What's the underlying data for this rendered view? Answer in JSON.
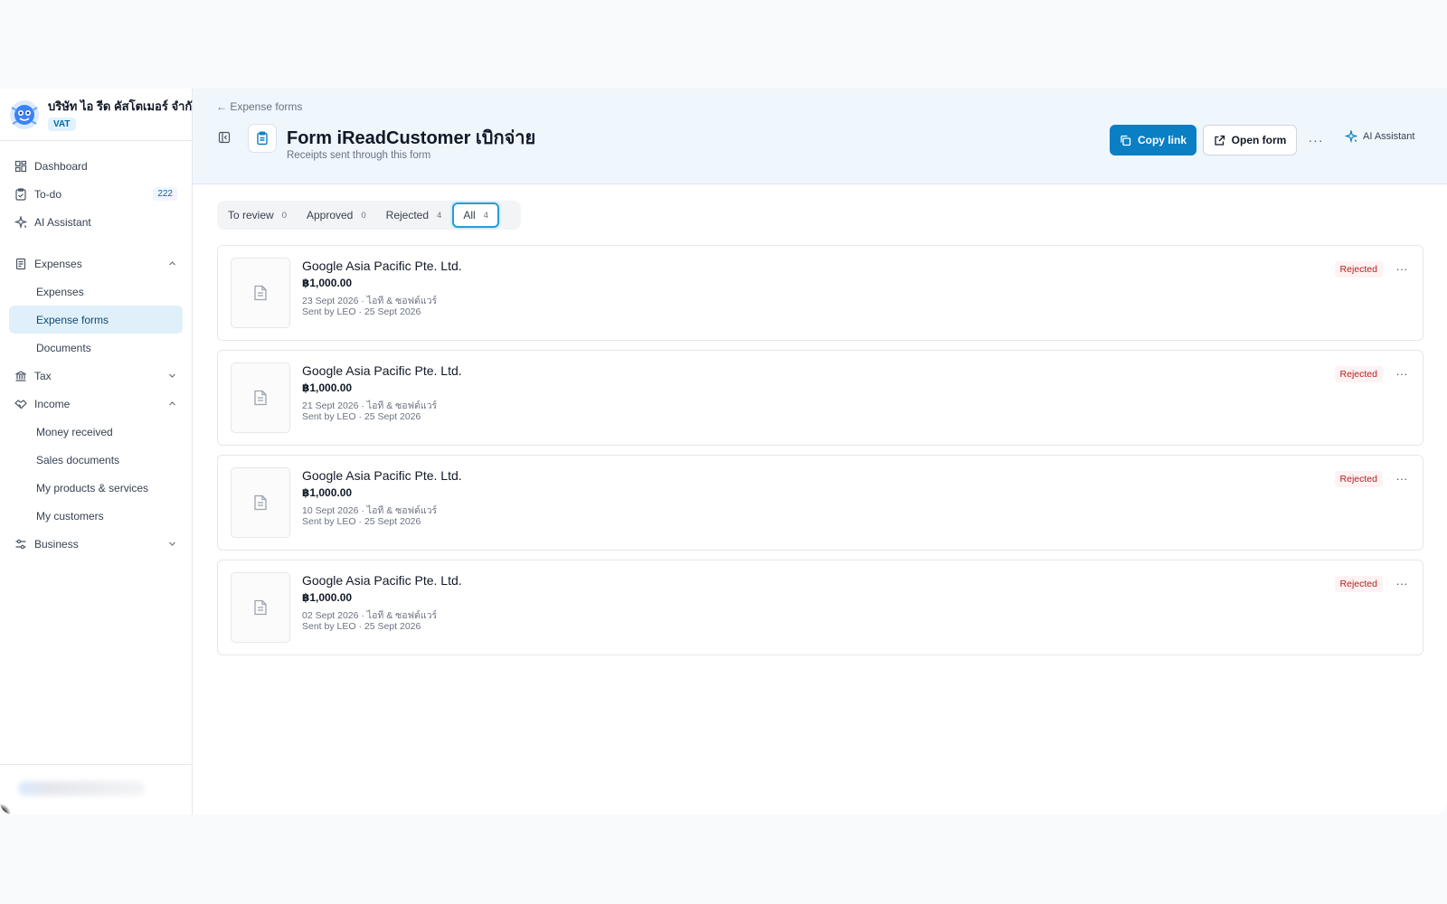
{
  "org": {
    "name": "บริษัท ไอ รีด คัสโตเมอร์ จำกัด",
    "badge": "VAT"
  },
  "sidebar": {
    "items": [
      {
        "label": "Dashboard",
        "icon": "dashboard-icon"
      },
      {
        "label": "To-do",
        "icon": "clipboard-check-icon",
        "count": "222"
      },
      {
        "label": "AI Assistant",
        "icon": "sparkle-icon"
      },
      {
        "label": "Expenses",
        "icon": "receipt-icon",
        "expanded": true
      },
      {
        "label": "Expenses"
      },
      {
        "label": "Expense forms",
        "active": true
      },
      {
        "label": "Documents"
      },
      {
        "label": "Tax",
        "icon": "bank-icon",
        "expanded": false
      },
      {
        "label": "Income",
        "icon": "handshake-icon",
        "expanded": true
      },
      {
        "label": "Money received"
      },
      {
        "label": "Sales documents"
      },
      {
        "label": "My products & services"
      },
      {
        "label": "My customers"
      },
      {
        "label": "Business",
        "icon": "sliders-icon",
        "expanded": false
      }
    ]
  },
  "header": {
    "back_label": "← Expense forms",
    "title": "Form iReadCustomer เบิกจ่าย",
    "subtitle": "Receipts sent through this form",
    "copy_link": "Copy link",
    "open_form": "Open form",
    "more": "···",
    "ai_assistant": "AI Assistant"
  },
  "tabs": [
    {
      "label": "To review",
      "count": "0"
    },
    {
      "label": "Approved",
      "count": "0"
    },
    {
      "label": "Rejected",
      "count": "4"
    },
    {
      "label": "All",
      "count": "4",
      "active": true
    }
  ],
  "receipts": [
    {
      "vendor": "Google Asia Pacific Pte. Ltd.",
      "amount": "฿1,000.00",
      "meta": "23 Sept 2026 · ไอที & ซอฟต์แวร์",
      "sent": "Sent by LEO · 25 Sept 2026",
      "status": "Rejected"
    },
    {
      "vendor": "Google Asia Pacific Pte. Ltd.",
      "amount": "฿1,000.00",
      "meta": "21 Sept 2026 · ไอที & ซอฟต์แวร์",
      "sent": "Sent by LEO · 25 Sept 2026",
      "status": "Rejected"
    },
    {
      "vendor": "Google Asia Pacific Pte. Ltd.",
      "amount": "฿1,000.00",
      "meta": "10 Sept 2026 · ไอที & ซอฟต์แวร์",
      "sent": "Sent by LEO · 25 Sept 2026",
      "status": "Rejected"
    },
    {
      "vendor": "Google Asia Pacific Pte. Ltd.",
      "amount": "฿1,000.00",
      "meta": "02 Sept 2026 · ไอที & ซอฟต์แวร์",
      "sent": "Sent by LEO · 25 Sept 2026",
      "status": "Rejected"
    }
  ],
  "colors": {
    "accent": "#0a7fc4",
    "header_bg": "#eff6fc",
    "rejected": "#b91c1c",
    "active_nav_bg": "#e0f0fb"
  }
}
